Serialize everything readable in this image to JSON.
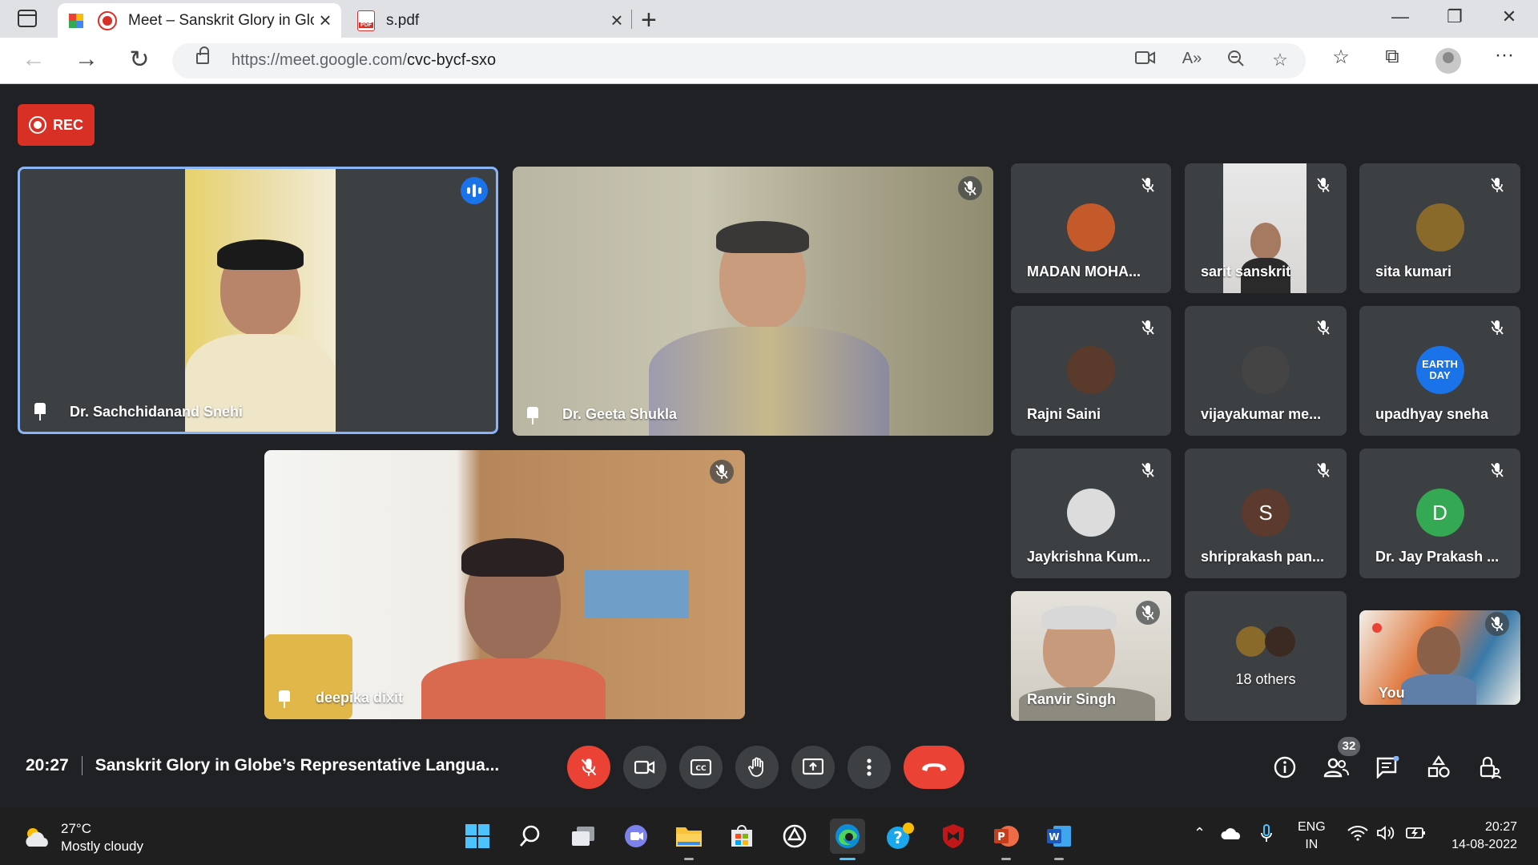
{
  "browser": {
    "tabs": [
      {
        "title": "Meet – Sanskrit Glory in Globe's Representative Language",
        "active": true
      },
      {
        "title": "s.pdf",
        "active": false
      }
    ],
    "url_host": "https://meet.google.com/",
    "url_path": "cvc-bycf-sxo",
    "window_controls": [
      "minimize",
      "restore",
      "close"
    ]
  },
  "meeting": {
    "rec_label": "REC",
    "time": "20:27",
    "title": "Sanskrit Glory in Globe’s Representative Langua...",
    "participant_badge": "32",
    "main_tiles": [
      {
        "name": "Dr. Sachchidanand Snehi",
        "speaking": true
      },
      {
        "name": "Dr. Geeta Shukla",
        "muted": true
      },
      {
        "name": "deepika dixit",
        "muted": true
      }
    ],
    "grid_tiles": [
      {
        "name": "MADAN MOHA...",
        "kind": "photo",
        "color": "#c45a2a"
      },
      {
        "name": "sarit sanskrit",
        "kind": "video"
      },
      {
        "name": "sita kumari",
        "kind": "photo",
        "color": "#8a6a2a"
      },
      {
        "name": "Rajni Saini",
        "kind": "photo",
        "color": "#5a3a2a"
      },
      {
        "name": "vijayakumar me...",
        "kind": "photo",
        "color": "#444"
      },
      {
        "name": "upadhyay sneha",
        "kind": "photo",
        "color": "#1a73e8",
        "photo_text": "EARTH DAY"
      },
      {
        "name": "Jaykrishna Kum...",
        "kind": "photo",
        "color": "#dcdcdc"
      },
      {
        "name": "shriprakash pan...",
        "kind": "letter",
        "letter": "S",
        "color": "#5d3a2e"
      },
      {
        "name": "Dr. Jay Prakash ...",
        "kind": "letter",
        "letter": "D",
        "color": "#34a853"
      },
      {
        "name": "Ranvir Singh",
        "kind": "video"
      },
      {
        "name": "18 others",
        "kind": "others"
      },
      {
        "name": "You",
        "kind": "self"
      }
    ]
  },
  "taskbar": {
    "temperature": "27°C",
    "weather": "Mostly cloudy",
    "lang_line1": "ENG",
    "lang_line2": "IN",
    "clock_time": "20:27",
    "clock_date": "14-08-2022"
  },
  "colors": {
    "meet_bg": "#202124",
    "tile_bg": "#3c4043",
    "red": "#ea4335",
    "speaking_blue": "#1a73e8"
  }
}
